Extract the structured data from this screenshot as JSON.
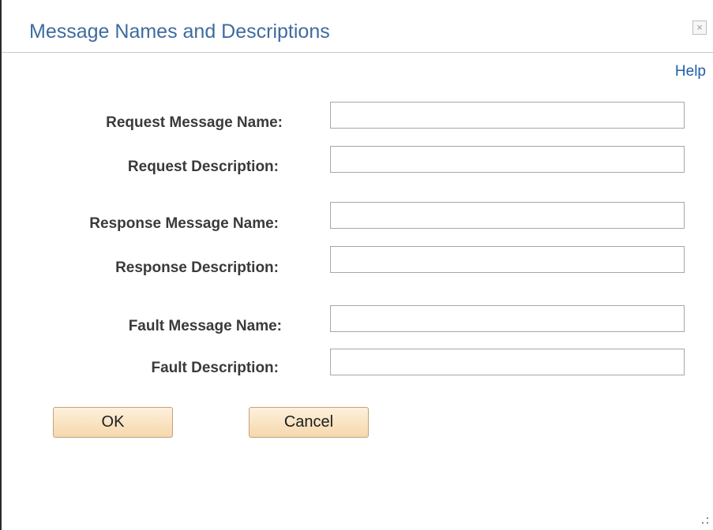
{
  "dialog": {
    "title": "Message Names and Descriptions",
    "close_glyph": "×",
    "help_label": "Help"
  },
  "fields": {
    "request_name": {
      "label": "Request Message Name:",
      "value": ""
    },
    "request_desc": {
      "label": "Request Description:",
      "value": ""
    },
    "response_name": {
      "label": "Response Message Name:",
      "value": ""
    },
    "response_desc": {
      "label": "Response Description:",
      "value": ""
    },
    "fault_name": {
      "label": "Fault Message Name:",
      "value": ""
    },
    "fault_desc": {
      "label": "Fault Description:",
      "value": ""
    }
  },
  "buttons": {
    "ok_label": "OK",
    "cancel_label": "Cancel"
  },
  "colors": {
    "title": "#3e6b9f",
    "link": "#1f5fa9",
    "button_top": "#fdf0dc",
    "button_bottom": "#f6d8ac",
    "button_border": "#c4a27a"
  },
  "icons": {
    "close": "close-icon",
    "resize": "resize-grip-icon"
  }
}
